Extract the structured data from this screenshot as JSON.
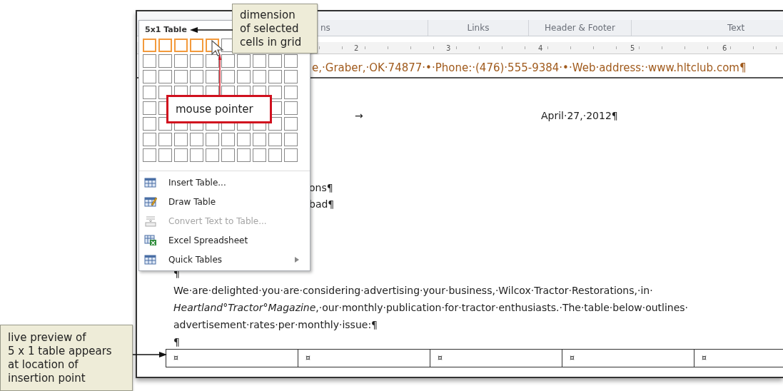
{
  "ribbon": {
    "group_labels": [
      "ns",
      "Links",
      "Header & Footer",
      "Text"
    ]
  },
  "ruler": {
    "numbers": [
      "2",
      "3",
      "4",
      "5",
      "6"
    ]
  },
  "document": {
    "header_line": "e,·Graber,·OK·74877·•·Phone:·(476)·555-9384·•·Web·address:·www.hltclub.com¶",
    "tab_mark": "→",
    "date": "April·27,·2012¶",
    "fragments": [
      "ons¶",
      "bad¶"
    ],
    "blank_paragraph": "¶",
    "body_lines": [
      "We·are·delighted·you·are·considering·advertising·your·business,·Wilcox·Tractor·Restorations,·in·",
      "*Heartland°Tractor°Magazine*,·our·monthly·publication·for·tractor·enthusiasts.·The·table·below·outlines·",
      "advertisement·rates·per·monthly·issue:¶"
    ],
    "after_paragraph": "¶",
    "preview_table": {
      "cells": [
        "¤",
        "¤",
        "¤",
        "¤",
        "¤"
      ]
    }
  },
  "table_menu": {
    "title": "5x1 Table",
    "grid": [
      {
        "cells": [
          {
            "selected": true
          },
          {
            "selected": true
          },
          {
            "selected": true
          },
          {
            "selected": true
          },
          {
            "selected": true
          },
          {
            "selected": false
          }
        ]
      },
      {
        "cells": [
          {
            "selected": false
          },
          {
            "selected": false
          },
          {
            "selected": false
          },
          {
            "selected": false
          },
          {
            "selected": false
          },
          {
            "selected": false
          },
          {
            "selected": false
          },
          {
            "selected": false
          },
          {
            "selected": false
          },
          {
            "selected": false
          }
        ]
      },
      {
        "cells": [
          {
            "selected": false
          },
          {
            "selected": false
          },
          {
            "selected": false
          },
          {
            "selected": false
          },
          {
            "selected": false
          },
          {
            "selected": false
          },
          {
            "selected": false
          },
          {
            "selected": false
          },
          {
            "selected": false
          },
          {
            "selected": false
          }
        ]
      },
      {
        "cells": [
          {
            "selected": false
          },
          {
            "selected": false
          },
          {
            "selected": false
          },
          {
            "selected": false
          },
          {
            "selected": false
          },
          {
            "selected": false
          },
          {
            "selected": false
          },
          {
            "selected": false
          },
          {
            "selected": false
          },
          {
            "selected": false
          }
        ]
      },
      {
        "cells": [
          {
            "selected": false
          },
          {
            "selected": false
          },
          {
            "selected": false
          },
          {
            "selected": false
          }
        ]
      },
      {
        "cells": [
          {
            "selected": false
          },
          {
            "selected": false
          },
          {
            "selected": false
          },
          {
            "selected": false
          },
          {
            "selected": false
          },
          {
            "selected": false
          },
          {
            "selected": false
          },
          {
            "selected": false
          },
          {
            "selected": false
          },
          {
            "selected": false
          }
        ]
      },
      {
        "cells": [
          {
            "selected": false
          },
          {
            "selected": false
          },
          {
            "selected": false
          },
          {
            "selected": false
          },
          {
            "selected": false
          },
          {
            "selected": false
          },
          {
            "selected": false
          },
          {
            "selected": false
          },
          {
            "selected": false
          },
          {
            "selected": false
          }
        ]
      },
      {
        "cells": [
          {
            "selected": false
          },
          {
            "selected": false
          },
          {
            "selected": false
          },
          {
            "selected": false
          },
          {
            "selected": false
          },
          {
            "selected": false
          },
          {
            "selected": false
          },
          {
            "selected": false
          },
          {
            "selected": false
          },
          {
            "selected": false
          }
        ]
      }
    ],
    "items": [
      {
        "kind": "insert",
        "label": "Insert Table...",
        "disabled": false,
        "submenu": false
      },
      {
        "kind": "draw",
        "label": "Draw Table",
        "disabled": false,
        "submenu": false
      },
      {
        "kind": "convert",
        "label": "Convert Text to Table...",
        "disabled": true,
        "submenu": false
      },
      {
        "kind": "excel",
        "label": "Excel Spreadsheet",
        "disabled": false,
        "submenu": false
      },
      {
        "kind": "quick",
        "label": "Quick Tables",
        "disabled": false,
        "submenu": true
      }
    ]
  },
  "callouts": [
    {
      "kind": "note",
      "lines": [
        "dimension",
        "of selected",
        "cells in grid"
      ]
    },
    {
      "kind": "label",
      "lines": [
        "mouse pointer"
      ]
    },
    {
      "kind": "note",
      "lines": [
        "live preview of",
        "5 x 1 table appears",
        "at location of",
        "insertion point"
      ]
    }
  ]
}
